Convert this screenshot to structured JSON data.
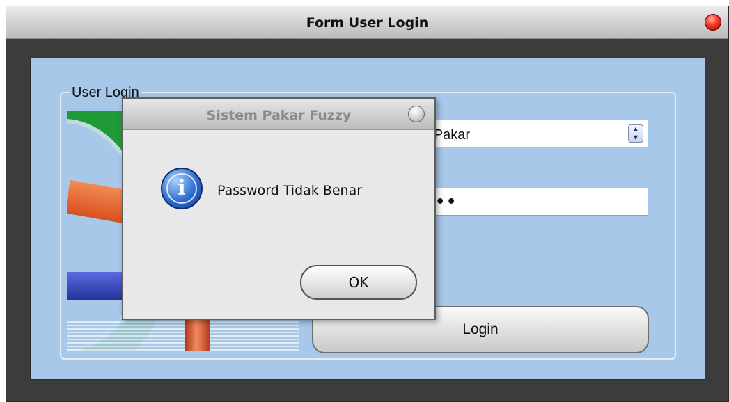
{
  "window": {
    "title": "Form User Login",
    "close_icon": "close-icon",
    "accent": "#a8c8ea"
  },
  "groupbox": {
    "legend": "User Login"
  },
  "login_form": {
    "user_type_value": "min/Pakar",
    "password_value": "••••",
    "login_label": "Login"
  },
  "dialog": {
    "title": "Sistem Pakar Fuzzy",
    "message": "Password Tidak Benar",
    "ok_label": "OK",
    "icon": "info-icon",
    "icon_glyph": "i"
  }
}
